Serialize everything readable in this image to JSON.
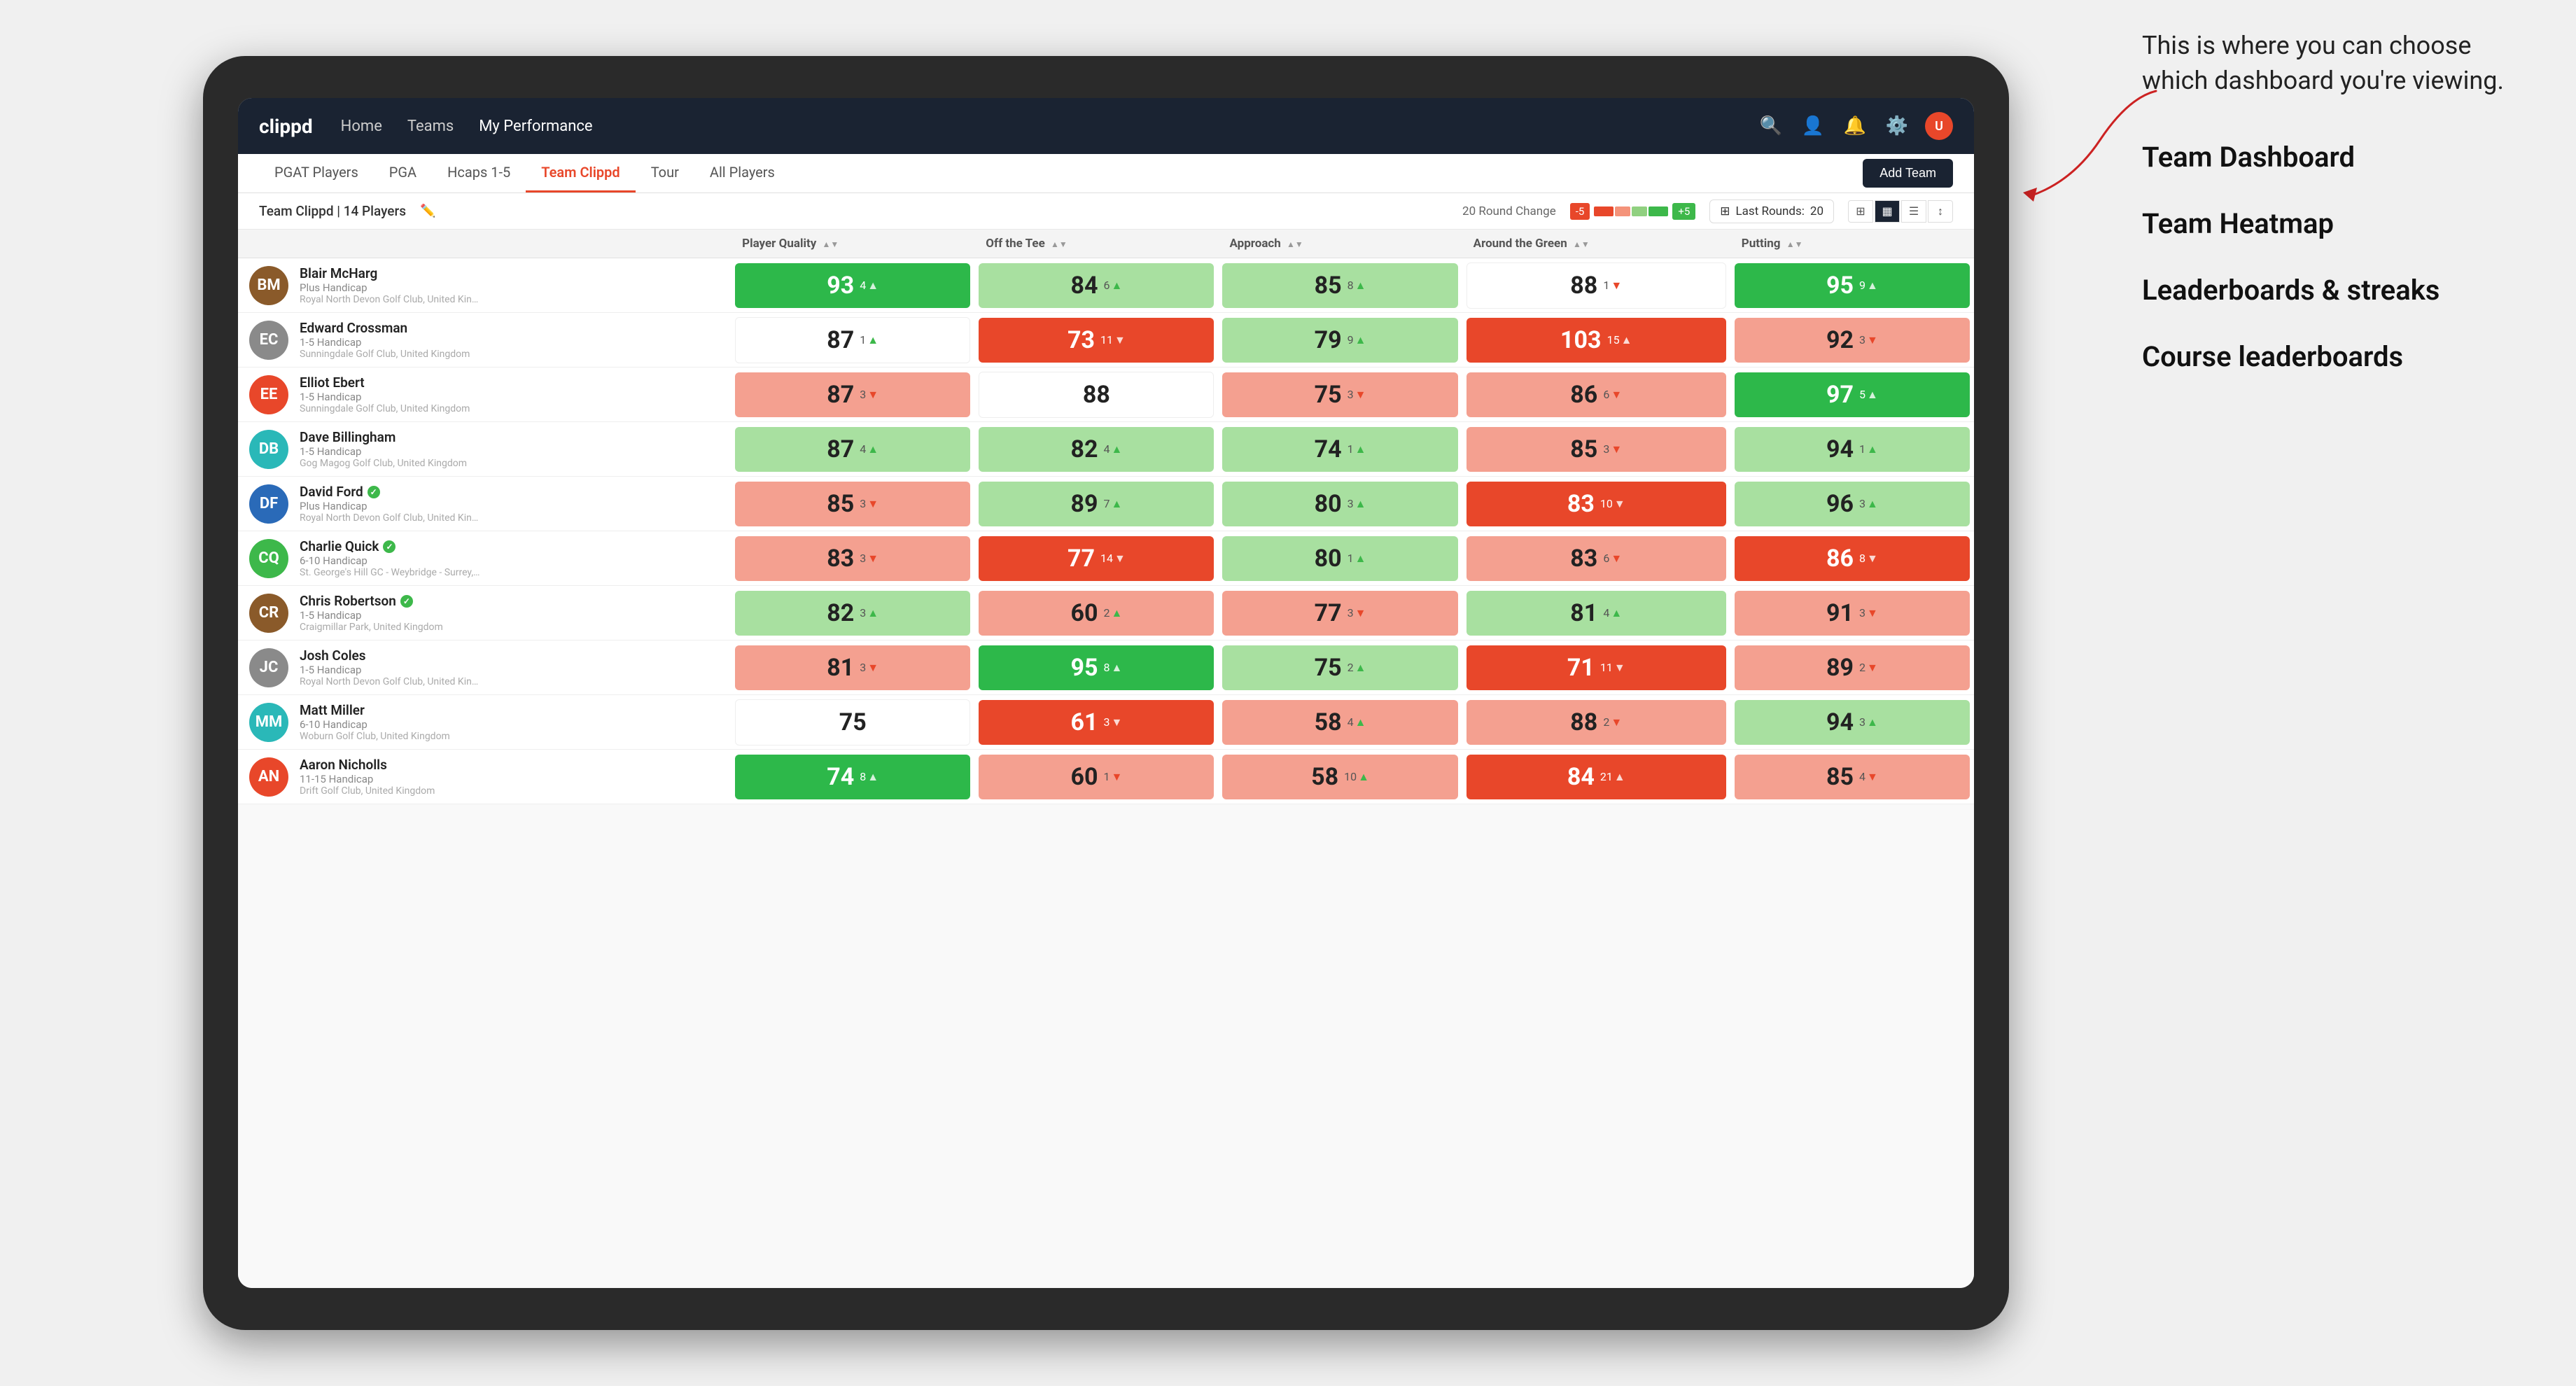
{
  "annotation": {
    "callout": "This is where you can choose which dashboard you're viewing.",
    "items": [
      "Team Dashboard",
      "Team Heatmap",
      "Leaderboards & streaks",
      "Course leaderboards"
    ]
  },
  "nav": {
    "logo": "clippd",
    "links": [
      {
        "label": "Home",
        "active": false
      },
      {
        "label": "Teams",
        "active": false
      },
      {
        "label": "My Performance",
        "active": false
      }
    ]
  },
  "sub_tabs": [
    {
      "label": "PGAT Players",
      "active": false
    },
    {
      "label": "PGA",
      "active": false
    },
    {
      "label": "Hcaps 1-5",
      "active": false
    },
    {
      "label": "Team Clippd",
      "active": true
    },
    {
      "label": "Tour",
      "active": false
    },
    {
      "label": "All Players",
      "active": false
    }
  ],
  "add_team_label": "Add Team",
  "team_info": {
    "name": "Team Clippd",
    "players_count": "14 Players",
    "round_change_label": "20 Round Change",
    "change_neg": "-5",
    "change_pos": "+5",
    "last_rounds_label": "Last Rounds:",
    "last_rounds_value": "20"
  },
  "columns": [
    {
      "label": "Player Quality",
      "sortable": true,
      "key": "player_quality"
    },
    {
      "label": "Off the Tee",
      "sortable": true,
      "key": "off_tee"
    },
    {
      "label": "Approach",
      "sortable": true,
      "key": "approach"
    },
    {
      "label": "Around the Green",
      "sortable": true,
      "key": "around_green"
    },
    {
      "label": "Putting",
      "sortable": true,
      "key": "putting"
    }
  ],
  "players": [
    {
      "name": "Blair McHarg",
      "handicap": "Plus Handicap",
      "club": "Royal North Devon Golf Club, United Kingdom",
      "avatar_color": "brown",
      "avatar_initials": "BM",
      "verified": false,
      "player_quality": {
        "value": 93,
        "change": 4,
        "direction": "up",
        "bg": "green-dark"
      },
      "off_tee": {
        "value": 84,
        "change": 6,
        "direction": "up",
        "bg": "green-light"
      },
      "approach": {
        "value": 85,
        "change": 8,
        "direction": "up",
        "bg": "green-light"
      },
      "around_green": {
        "value": 88,
        "change": 1,
        "direction": "down",
        "bg": "white"
      },
      "putting": {
        "value": 95,
        "change": 9,
        "direction": "up",
        "bg": "green-dark"
      }
    },
    {
      "name": "Edward Crossman",
      "handicap": "1-5 Handicap",
      "club": "Sunningdale Golf Club, United Kingdom",
      "avatar_color": "gray",
      "avatar_initials": "EC",
      "verified": false,
      "player_quality": {
        "value": 87,
        "change": 1,
        "direction": "up",
        "bg": "white"
      },
      "off_tee": {
        "value": 73,
        "change": 11,
        "direction": "down",
        "bg": "red-dark"
      },
      "approach": {
        "value": 79,
        "change": 9,
        "direction": "up",
        "bg": "green-light"
      },
      "around_green": {
        "value": 103,
        "change": 15,
        "direction": "up",
        "bg": "red-dark"
      },
      "putting": {
        "value": 92,
        "change": 3,
        "direction": "down",
        "bg": "red-light"
      }
    },
    {
      "name": "Elliot Ebert",
      "handicap": "1-5 Handicap",
      "club": "Sunningdale Golf Club, United Kingdom",
      "avatar_color": "orange",
      "avatar_initials": "EE",
      "verified": false,
      "player_quality": {
        "value": 87,
        "change": 3,
        "direction": "down",
        "bg": "red-light"
      },
      "off_tee": {
        "value": 88,
        "change": 0,
        "direction": "none",
        "bg": "white"
      },
      "approach": {
        "value": 75,
        "change": 3,
        "direction": "down",
        "bg": "red-light"
      },
      "around_green": {
        "value": 86,
        "change": 6,
        "direction": "down",
        "bg": "red-light"
      },
      "putting": {
        "value": 97,
        "change": 5,
        "direction": "up",
        "bg": "green-dark"
      }
    },
    {
      "name": "Dave Billingham",
      "handicap": "1-5 Handicap",
      "club": "Gog Magog Golf Club, United Kingdom",
      "avatar_color": "teal",
      "avatar_initials": "DB",
      "verified": false,
      "player_quality": {
        "value": 87,
        "change": 4,
        "direction": "up",
        "bg": "green-light"
      },
      "off_tee": {
        "value": 82,
        "change": 4,
        "direction": "up",
        "bg": "green-light"
      },
      "approach": {
        "value": 74,
        "change": 1,
        "direction": "up",
        "bg": "green-light"
      },
      "around_green": {
        "value": 85,
        "change": 3,
        "direction": "down",
        "bg": "red-light"
      },
      "putting": {
        "value": 94,
        "change": 1,
        "direction": "up",
        "bg": "green-light"
      }
    },
    {
      "name": "David Ford",
      "handicap": "Plus Handicap",
      "club": "Royal North Devon Golf Club, United Kingdom",
      "avatar_color": "blue",
      "avatar_initials": "DF",
      "verified": true,
      "player_quality": {
        "value": 85,
        "change": 3,
        "direction": "down",
        "bg": "red-light"
      },
      "off_tee": {
        "value": 89,
        "change": 7,
        "direction": "up",
        "bg": "green-light"
      },
      "approach": {
        "value": 80,
        "change": 3,
        "direction": "up",
        "bg": "green-light"
      },
      "around_green": {
        "value": 83,
        "change": 10,
        "direction": "down",
        "bg": "red-dark"
      },
      "putting": {
        "value": 96,
        "change": 3,
        "direction": "up",
        "bg": "green-light"
      }
    },
    {
      "name": "Charlie Quick",
      "handicap": "6-10 Handicap",
      "club": "St. George's Hill GC - Weybridge - Surrey, Uni...",
      "avatar_color": "green",
      "avatar_initials": "CQ",
      "verified": true,
      "player_quality": {
        "value": 83,
        "change": 3,
        "direction": "down",
        "bg": "red-light"
      },
      "off_tee": {
        "value": 77,
        "change": 14,
        "direction": "down",
        "bg": "red-dark"
      },
      "approach": {
        "value": 80,
        "change": 1,
        "direction": "up",
        "bg": "green-light"
      },
      "around_green": {
        "value": 83,
        "change": 6,
        "direction": "down",
        "bg": "red-light"
      },
      "putting": {
        "value": 86,
        "change": 8,
        "direction": "down",
        "bg": "red-dark"
      }
    },
    {
      "name": "Chris Robertson",
      "handicap": "1-5 Handicap",
      "club": "Craigmillar Park, United Kingdom",
      "avatar_color": "brown",
      "avatar_initials": "CR",
      "verified": true,
      "player_quality": {
        "value": 82,
        "change": 3,
        "direction": "up",
        "bg": "green-light"
      },
      "off_tee": {
        "value": 60,
        "change": 2,
        "direction": "up",
        "bg": "red-light"
      },
      "approach": {
        "value": 77,
        "change": 3,
        "direction": "down",
        "bg": "red-light"
      },
      "around_green": {
        "value": 81,
        "change": 4,
        "direction": "up",
        "bg": "green-light"
      },
      "putting": {
        "value": 91,
        "change": 3,
        "direction": "down",
        "bg": "red-light"
      }
    },
    {
      "name": "Josh Coles",
      "handicap": "1-5 Handicap",
      "club": "Royal North Devon Golf Club, United Kingdom",
      "avatar_color": "gray",
      "avatar_initials": "JC",
      "verified": false,
      "player_quality": {
        "value": 81,
        "change": 3,
        "direction": "down",
        "bg": "red-light"
      },
      "off_tee": {
        "value": 95,
        "change": 8,
        "direction": "up",
        "bg": "green-dark"
      },
      "approach": {
        "value": 75,
        "change": 2,
        "direction": "up",
        "bg": "green-light"
      },
      "around_green": {
        "value": 71,
        "change": 11,
        "direction": "down",
        "bg": "red-dark"
      },
      "putting": {
        "value": 89,
        "change": 2,
        "direction": "down",
        "bg": "red-light"
      }
    },
    {
      "name": "Matt Miller",
      "handicap": "6-10 Handicap",
      "club": "Woburn Golf Club, United Kingdom",
      "avatar_color": "teal",
      "avatar_initials": "MM",
      "verified": false,
      "player_quality": {
        "value": 75,
        "change": 0,
        "direction": "none",
        "bg": "white"
      },
      "off_tee": {
        "value": 61,
        "change": 3,
        "direction": "down",
        "bg": "red-dark"
      },
      "approach": {
        "value": 58,
        "change": 4,
        "direction": "up",
        "bg": "red-light"
      },
      "around_green": {
        "value": 88,
        "change": 2,
        "direction": "down",
        "bg": "red-light"
      },
      "putting": {
        "value": 94,
        "change": 3,
        "direction": "up",
        "bg": "green-light"
      }
    },
    {
      "name": "Aaron Nicholls",
      "handicap": "11-15 Handicap",
      "club": "Drift Golf Club, United Kingdom",
      "avatar_color": "orange",
      "avatar_initials": "AN",
      "verified": false,
      "player_quality": {
        "value": 74,
        "change": 8,
        "direction": "up",
        "bg": "green-dark"
      },
      "off_tee": {
        "value": 60,
        "change": 1,
        "direction": "down",
        "bg": "red-light"
      },
      "approach": {
        "value": 58,
        "change": 10,
        "direction": "up",
        "bg": "red-light"
      },
      "around_green": {
        "value": 84,
        "change": 21,
        "direction": "up",
        "bg": "red-dark"
      },
      "putting": {
        "value": 85,
        "change": 4,
        "direction": "down",
        "bg": "red-light"
      }
    }
  ]
}
